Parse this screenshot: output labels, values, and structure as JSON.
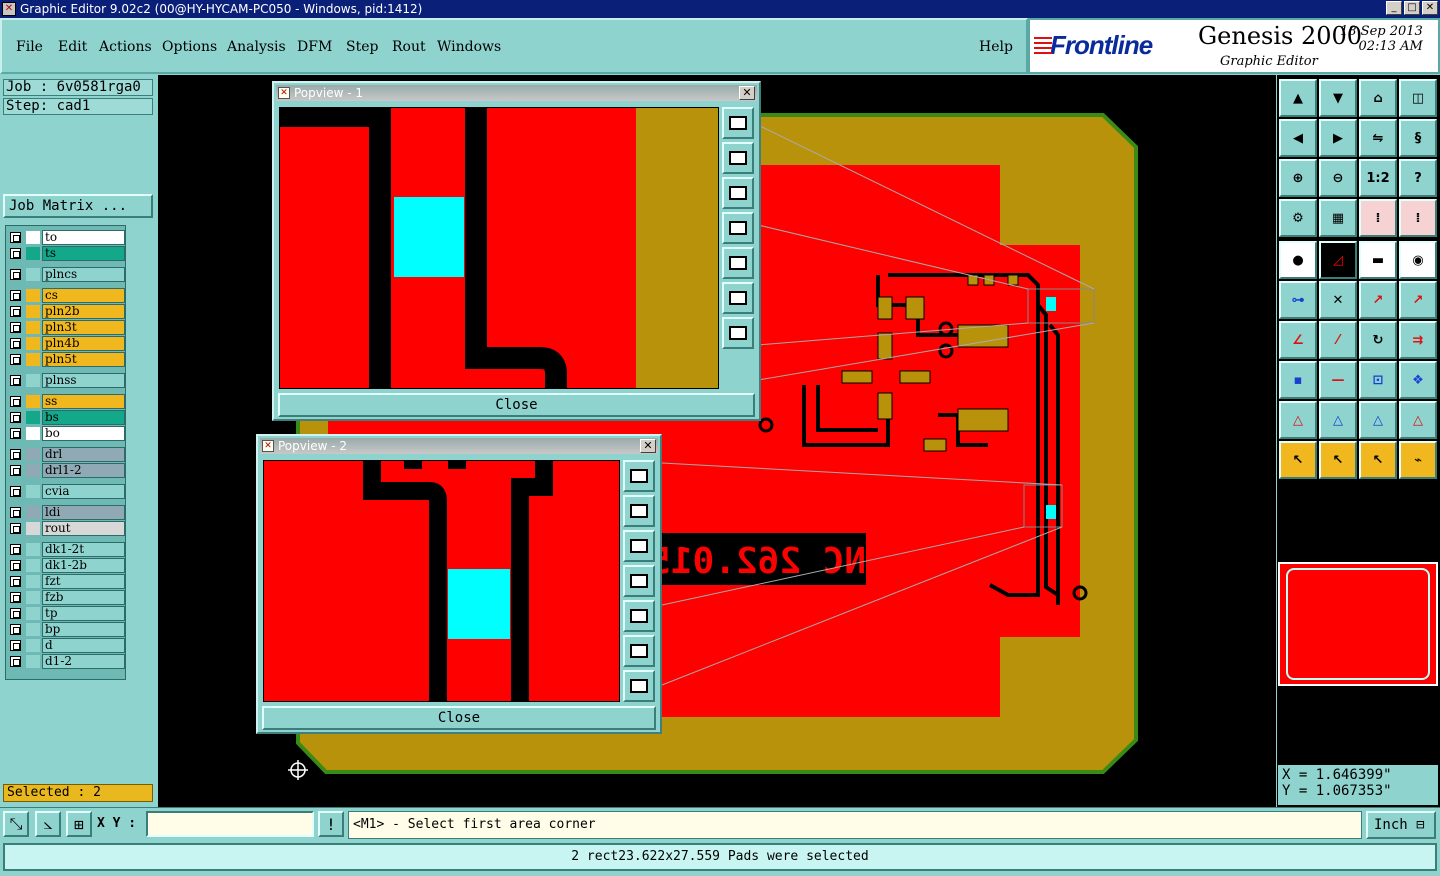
{
  "window": {
    "title": "Graphic Editor 9.02c2 (00@HY-HYCAM-PC050 - Windows, pid:1412)",
    "min": "_",
    "max": "□",
    "close": "✕"
  },
  "menu": {
    "file": "File",
    "edit": "Edit",
    "actions": "Actions",
    "options": "Options",
    "analysis": "Analysis",
    "dfm": "DFM",
    "step": "Step",
    "rout": "Rout",
    "windows": "Windows",
    "help": "Help"
  },
  "brand": {
    "logo": "Frontline",
    "title": "Genesis 2000",
    "subtitle": "Graphic Editor",
    "date": "18 Sep 2013",
    "time": "02:13 AM"
  },
  "info": {
    "job": "Job : 6v0581rga0",
    "step": "Step: cad1",
    "job_matrix": "Job Matrix ...",
    "selected": "Selected : 2"
  },
  "layers": [
    {
      "name": "to",
      "color": "#ffffff"
    },
    {
      "name": "ts",
      "color": "#14a88a"
    },
    {
      "name": "plncs",
      "color": "#8fd3cf"
    },
    {
      "name": "cs",
      "color": "#f0b81e"
    },
    {
      "name": "pln2b",
      "color": "#f0b81e"
    },
    {
      "name": "pln3t",
      "color": "#f0b81e"
    },
    {
      "name": "pln4b",
      "color": "#f0b81e"
    },
    {
      "name": "pln5t",
      "color": "#f0b81e"
    },
    {
      "name": "plnss",
      "color": "#8fd3cf"
    },
    {
      "name": "ss",
      "color": "#f0b81e"
    },
    {
      "name": "bs",
      "color": "#14a88a"
    },
    {
      "name": "bo",
      "color": "#ffffff"
    },
    {
      "name": "drl",
      "color": "#8fa9b5"
    },
    {
      "name": "drl1-2",
      "color": "#8fa9b5"
    },
    {
      "name": "cvia",
      "color": "#8fd3cf"
    },
    {
      "name": "ldi",
      "color": "#8fa9b5"
    },
    {
      "name": "rout",
      "color": "#d8d8d8"
    },
    {
      "name": "dk1-2t",
      "color": "#8fd3cf"
    },
    {
      "name": "dk1-2b",
      "color": "#8fd3cf"
    },
    {
      "name": "fzt",
      "color": "#8fd3cf"
    },
    {
      "name": "fzb",
      "color": "#8fd3cf"
    },
    {
      "name": "tp",
      "color": "#8fd3cf"
    },
    {
      "name": "bp",
      "color": "#8fd3cf"
    },
    {
      "name": "d",
      "color": "#8fd3cf"
    },
    {
      "name": "d1-2",
      "color": "#8fd3cf"
    }
  ],
  "popview1": {
    "title": "Popview - 1",
    "close": "Close"
  },
  "popview2": {
    "title": "Popview - 2",
    "close": "Close"
  },
  "board": {
    "text": "NC 262.015"
  },
  "coords": {
    "x": "X = 1.646399\"",
    "y": "Y = 1.067353\""
  },
  "toolbar": {
    "xy_label": "X Y :",
    "xy_value": "",
    "prompt": "<M1> - Select first area corner",
    "unit": "Inch",
    "ratio": "1:2"
  },
  "status": "2 rect23.622x27.559 Pads were selected",
  "colors": {
    "panel": "#8fd3cf",
    "copper": "#ff0000",
    "board": "#b8920a",
    "trace": "#000000",
    "selected": "#00ffff"
  }
}
